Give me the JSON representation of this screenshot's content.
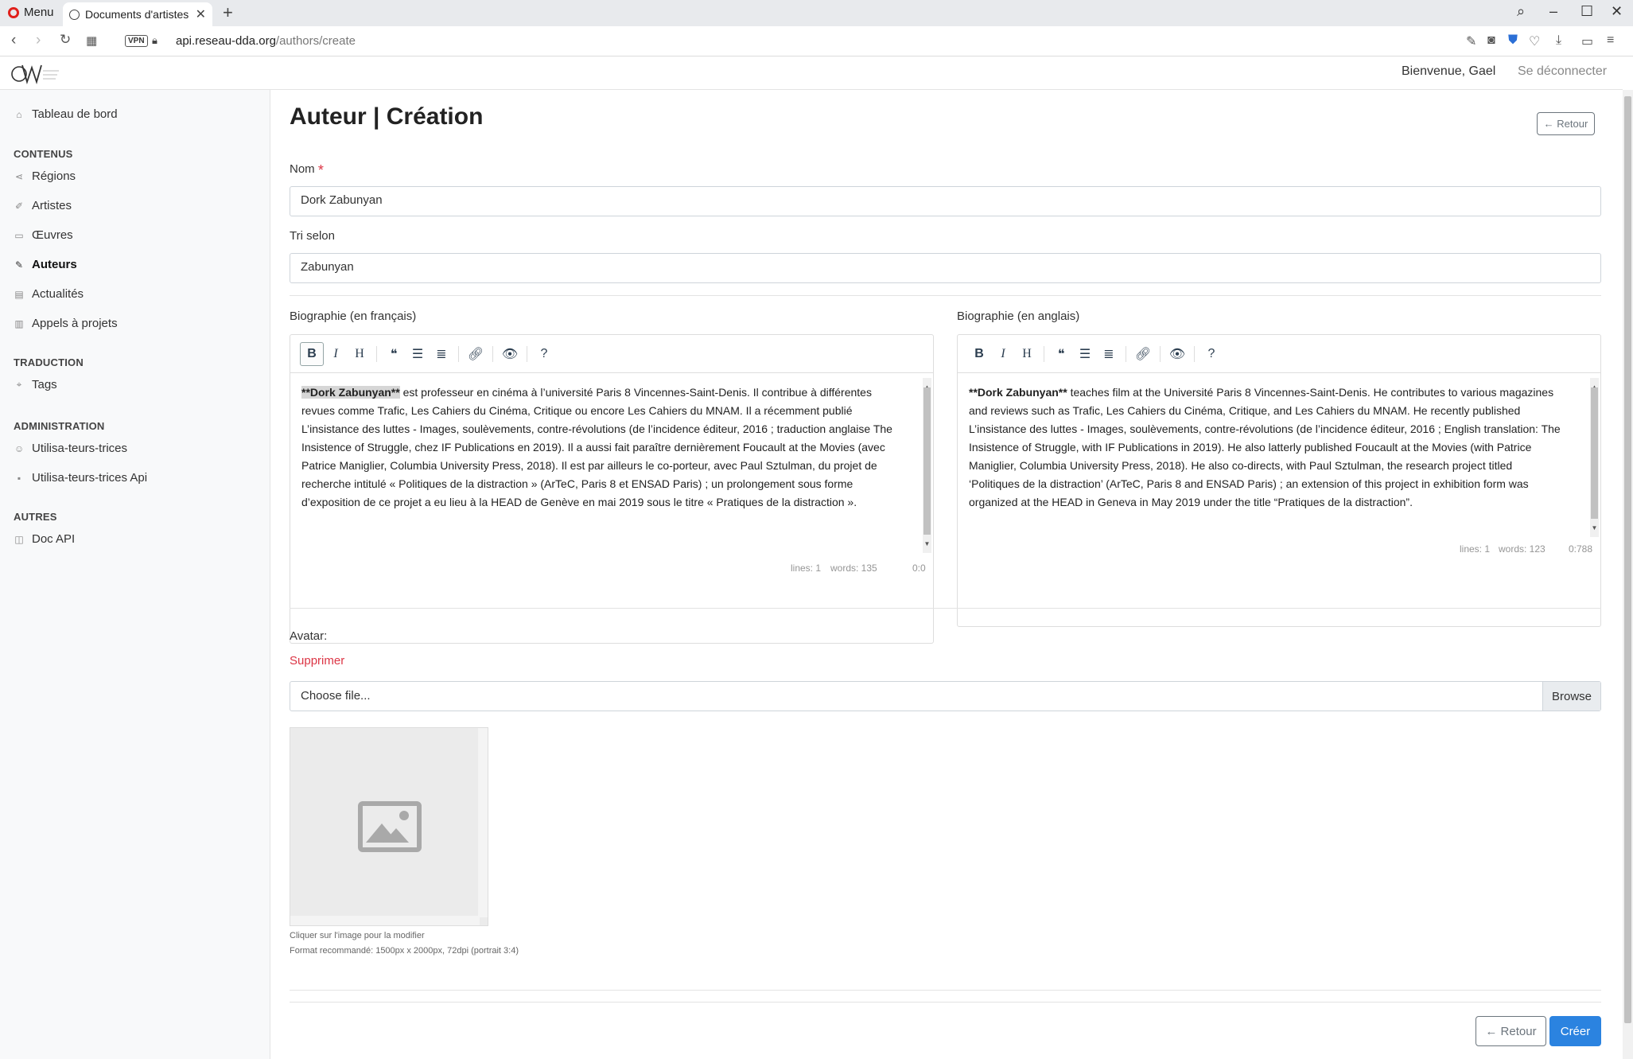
{
  "browser": {
    "menu_label": "Menu",
    "tab_title": "Documents d'artistes - A",
    "url_host": "api.reseau-dda.org",
    "url_path": "/authors/create",
    "vpn_label": "VPN"
  },
  "header": {
    "welcome": "Bienvenue, Gael",
    "logout": "Se déconnecter"
  },
  "sidebar": {
    "dashboard": "Tableau de bord",
    "sections": [
      {
        "title": "CONTENUS",
        "items": [
          "Régions",
          "Artistes",
          "Œuvres",
          "Auteurs",
          "Actualités",
          "Appels à projets"
        ]
      },
      {
        "title": "TRADUCTION",
        "items": [
          "Tags"
        ]
      },
      {
        "title": "ADMINISTRATION",
        "items": [
          "Utilisa-teurs-trices",
          "Utilisa-teurs-trices Api"
        ]
      },
      {
        "title": "AUTRES",
        "items": [
          "Doc API"
        ]
      }
    ],
    "active": "Auteurs"
  },
  "page": {
    "title": "Auteur | Création",
    "back_label": "← Retour"
  },
  "form": {
    "nom_label": "Nom",
    "required_mark": "*",
    "nom_value": "Dork Zabunyan",
    "tri_label": "Tri selon",
    "tri_value": "Zabunyan",
    "bio_fr": {
      "label": "Biographie (en français)",
      "highlight": "**Dork Zabunyan**",
      "text": " est professeur en cinéma à l’université Paris 8 Vincennes-Saint-Denis. Il contribue à différentes revues comme Trafic, Les Cahiers du Cinéma, Critique ou encore Les Cahiers du MNAM. Il a récemment publié L’insistance des luttes - Images, soulèvements, contre-révolutions (de l’incidence éditeur, 2016 ; traduction anglaise The Insistence of Struggle, chez IF Publications en 2019). Il a aussi fait paraître dernièrement Foucault at the Movies (avec Patrice Maniglier, Columbia University Press, 2018). Il est par ailleurs le co-porteur, avec Paul Sztulman, du projet de recherche intitulé « Politiques de la distraction » (ArTeC, Paris 8 et ENSAD Paris) ; un prolongement sous forme d’exposition de ce projet a eu lieu à la HEAD de Genève en mai 2019 sous le titre « Pratiques de la distraction ».",
      "lines": "lines: 1",
      "words": "words: 135",
      "cursor": "0:0"
    },
    "bio_en": {
      "label": "Biographie (en anglais)",
      "highlight": "**Dork Zabunyan**",
      "text": " teaches film at the Université Paris 8 Vincennes-Saint-Denis. He contributes to various magazines and reviews such as Trafic, Les Cahiers du Cinéma, Critique, and Les Cahiers du MNAM. He recently published L’insistance des luttes - Images, soulèvements, contre-révolutions (de l’incidence éditeur, 2016 ; English translation: The Insistence of Struggle, with IF Publications in 2019). He also latterly published Foucault at the Movies (with Patrice Maniglier, Columbia University Press, 2018). He also co-directs, with Paul Sztulman, the research project titled ‘Politiques de la distraction’ (ArTeC, Paris 8 and ENSAD Paris) ; an extension of this project in exhibition form was organized at the HEAD in Geneva in May 2019 under the title “Pratiques de la distraction”.",
      "lines": "lines: 1",
      "words": "words: 123",
      "cursor": "0:788"
    },
    "avatar_label": "Avatar:",
    "delete_label": "Supprimer",
    "file_placeholder": "Choose file...",
    "browse_label": "Browse",
    "hint1": "Cliquer sur l'image pour la modifier",
    "hint2": "Format recommandé: 1500px x 2000px, 72dpi (portrait 3:4)"
  },
  "footer": {
    "back_label": "← Retour",
    "create_label": "Créer"
  },
  "colors": {
    "primary": "#2b83e0",
    "danger": "#dc3545"
  }
}
